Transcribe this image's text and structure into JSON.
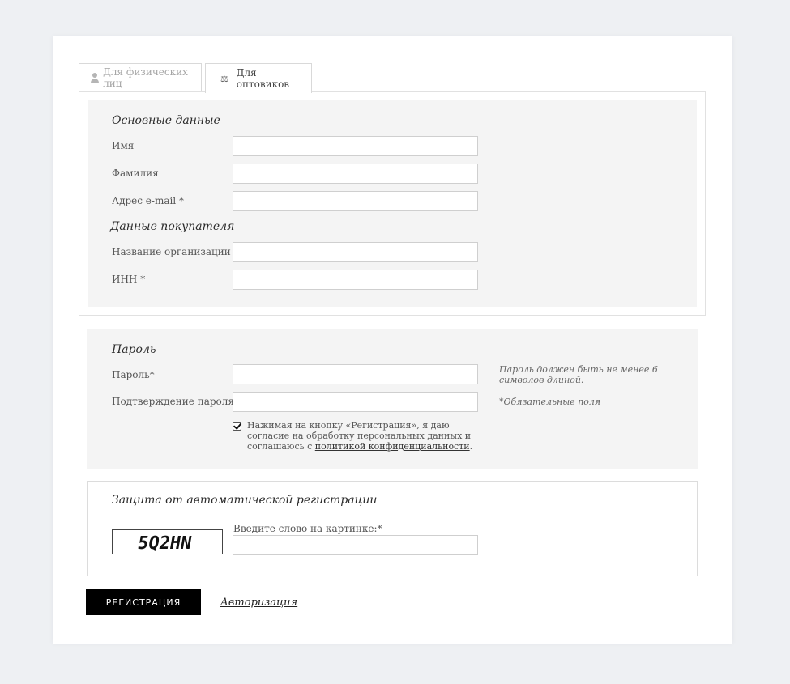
{
  "tabs": [
    {
      "label": "Для физических лиц",
      "icon": "person-icon",
      "active": false
    },
    {
      "label": "Для оптовиков",
      "icon": "wholesale-icon",
      "active": true
    }
  ],
  "basic": {
    "title": "Основные данные",
    "name_label": "Имя",
    "surname_label": "Фамилия",
    "email_label": "Адрес e-mail *"
  },
  "buyer": {
    "title": "Данные покупателя",
    "org_label": "Название организации *",
    "inn_label": "ИНН *"
  },
  "password": {
    "title": "Пароль",
    "password_label": "Пароль*",
    "confirm_label": "Подтверждение пароля*",
    "hint": "Пароль должен быть не менее 6 символов длиной.",
    "required_note": "*Обязательные поля",
    "consent_text": "Нажимая на кнопку «Регистрация», я даю согласие на обработку персональных данных и соглашаюсь с ",
    "consent_link": "политикой конфиденциальности",
    "consent_end": ".",
    "consent_checked": true
  },
  "captcha": {
    "title": "Защита от автоматической регистрации",
    "label": "Введите слово на картинке:*",
    "image_text": "5Q2HN"
  },
  "actions": {
    "register_label": "РЕГИСТРАЦИЯ",
    "auth_link": "Авторизация"
  }
}
